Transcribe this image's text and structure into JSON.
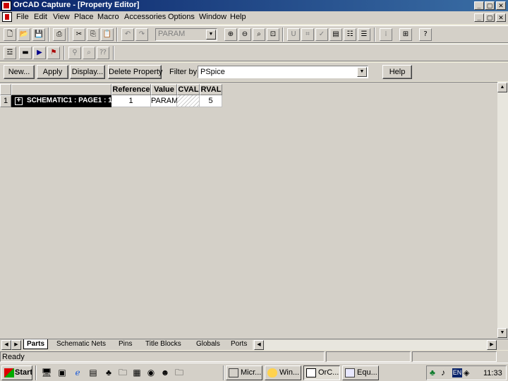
{
  "window": {
    "title": "OrCAD Capture - [Property Editor]",
    "caption_buttons": [
      "_",
      "▢",
      "✕"
    ],
    "doc_caption_buttons": [
      "_",
      "▢",
      "✕"
    ]
  },
  "menu": {
    "items": [
      "File",
      "Edit",
      "View",
      "Place",
      "Macro",
      "Accessories",
      "Options",
      "Window",
      "Help"
    ]
  },
  "toolbar": {
    "part_combo_value": "PARAM"
  },
  "property_editor": {
    "new_label": "New...",
    "apply_label": "Apply",
    "display_label": "Display...",
    "delete_label": "Delete Property",
    "filter_label": "Filter by",
    "filter_value": "PSpice",
    "help_label": "Help"
  },
  "grid": {
    "headers": [
      "Reference",
      "Value",
      "CVAL",
      "RVAL"
    ],
    "rows": [
      {
        "index": "1",
        "expand": "+",
        "name": "SCHEMATIC1 : PAGE1 : 1",
        "cells": [
          "1",
          "PARAM",
          "",
          "5"
        ]
      }
    ]
  },
  "tabs": [
    "Parts",
    "Schematic Nets",
    "Pins",
    "Title Blocks",
    "Globals",
    "Ports"
  ],
  "status": {
    "text": "Ready"
  },
  "taskbar": {
    "start_label": "Start",
    "buttons": [
      "Micr...",
      "Win...",
      "OrC...",
      "Equ..."
    ],
    "lang": "EN",
    "clock": "11:33"
  }
}
